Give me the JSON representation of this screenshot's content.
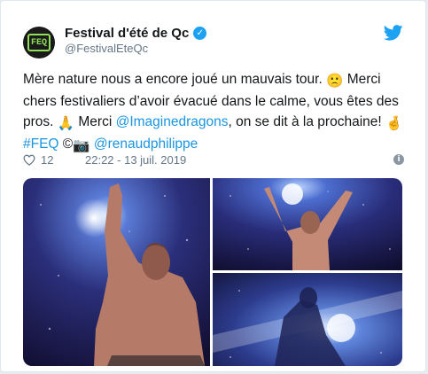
{
  "tweet": {
    "account_name": "Festival d'été de Qc",
    "handle": "@FestivalEteQc",
    "avatar_text": "FEQ",
    "text_segments": [
      {
        "t": "Mère nature nous a encore joué un mauvais tour. ",
        "kind": "text"
      },
      {
        "t": "🙁",
        "kind": "emoji"
      },
      {
        "t": " Merci chers festivaliers d’avoir évacué dans le calme, vous êtes des pros. ",
        "kind": "text"
      },
      {
        "t": "🙏",
        "kind": "emoji"
      },
      {
        "t": " Merci ",
        "kind": "text"
      },
      {
        "t": "@Imaginedragons",
        "kind": "link"
      },
      {
        "t": ", on se dit à la prochaine! ",
        "kind": "text"
      },
      {
        "t": "🤞",
        "kind": "emoji"
      },
      {
        "t": "#FEQ",
        "kind": "link"
      },
      {
        "t": " ©",
        "kind": "text"
      },
      {
        "t": "📷",
        "kind": "emoji"
      },
      {
        "t": " ",
        "kind": "text"
      },
      {
        "t": "@renaudphilippe",
        "kind": "link"
      }
    ],
    "likes": "12",
    "timestamp": "22:22 - 13 juil. 2019",
    "info_icon": "info-icon",
    "colors": {
      "link": "#1b95e0",
      "verified": "#1da1f2",
      "muted": "#657786"
    }
  }
}
